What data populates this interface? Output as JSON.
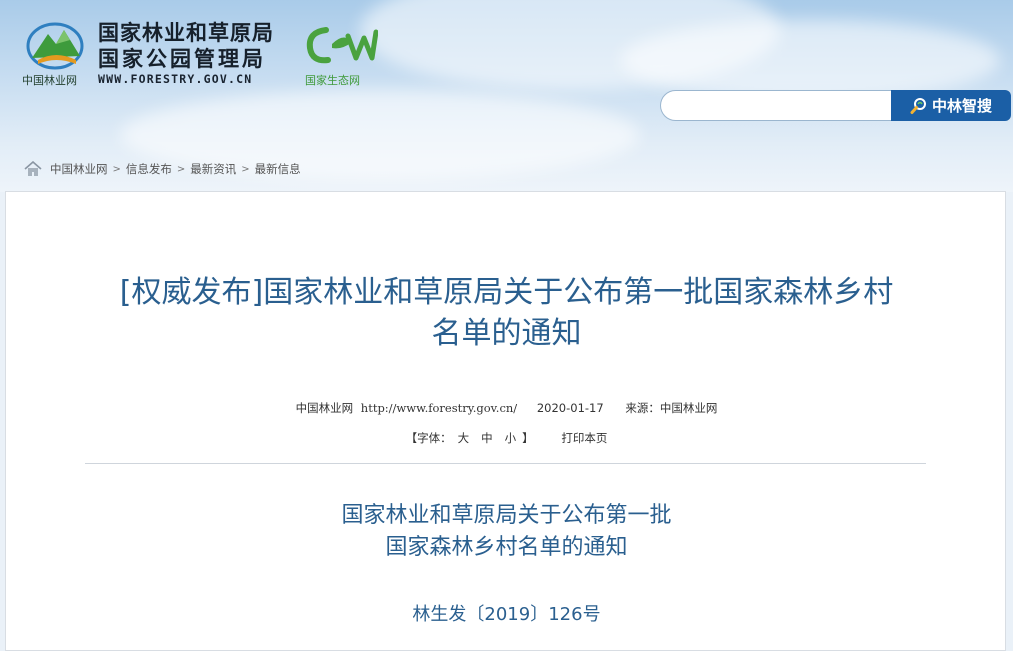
{
  "header": {
    "org_name_1": "国家林业和草原局",
    "org_name_2": "国家公园管理局",
    "site_url": "WWW.FORESTRY.GOV.CN",
    "logo_label": "中国林业网",
    "cen_label": "国家生态网",
    "logo_icon": "forestry-mountain-icon",
    "cen_icon": "cen-logo-icon"
  },
  "search": {
    "value": "",
    "placeholder": "",
    "button_label": "中林智搜",
    "icon": "magnifier-icon"
  },
  "breadcrumb": {
    "icon": "home-icon",
    "items": [
      "中国林业网",
      "信息发布",
      "最新资讯",
      "最新信息"
    ],
    "separator": ">"
  },
  "article": {
    "title_line_1": "[权威发布]国家林业和草原局关于公布第一批国家森林乡村",
    "title_line_2": "名单的通知",
    "source_site": "中国林业网",
    "source_url": "http://www.forestry.gov.cn/",
    "date": "2020-01-17",
    "source_label": "来源：中国林业网",
    "font_label": "【字体：",
    "font_large": "大",
    "font_medium": "中",
    "font_small": "小",
    "font_close": "】",
    "print_label": "打印本页",
    "body_title_1": "国家林业和草原局关于公布第一批",
    "body_title_2": "国家森林乡村名单的通知",
    "doc_number": "林生发〔2019〕126号"
  },
  "colors": {
    "title_blue": "#2a5f8f",
    "search_button": "#1b5fa6",
    "logo_green": "#3f9a3a"
  }
}
